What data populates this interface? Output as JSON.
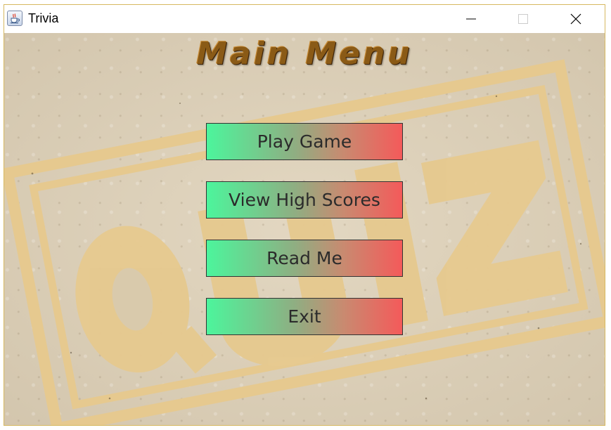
{
  "window": {
    "title": "Trivia",
    "icon": "java-cup-icon",
    "controls": [
      "minimize-icon",
      "maximize-icon",
      "close-icon"
    ]
  },
  "main": {
    "title": "Main Menu",
    "background_watermark": "QUIZ",
    "buttons": [
      {
        "label": "Play Game"
      },
      {
        "label": "View High Scores"
      },
      {
        "label": "Read Me"
      },
      {
        "label": "Exit"
      }
    ]
  },
  "colors": {
    "button_gradient_start": "#4cf59c",
    "button_gradient_end": "#f45a5a",
    "stamp": "#e6c98f",
    "paper": "#d7cab2",
    "window_border": "#d6b860"
  }
}
